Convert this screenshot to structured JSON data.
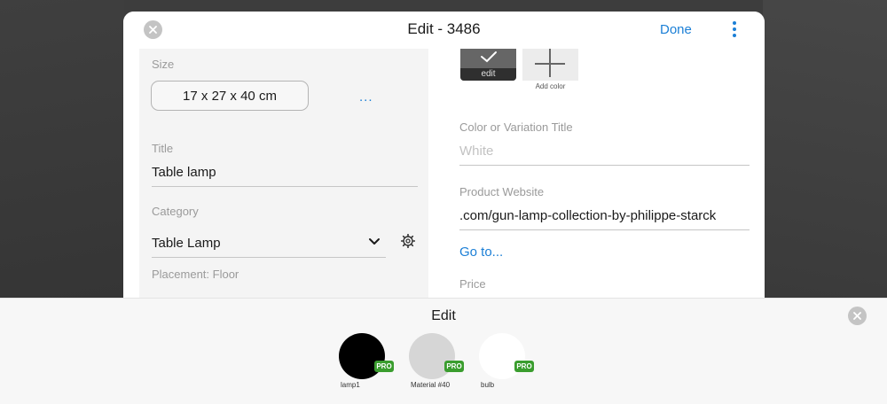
{
  "modal": {
    "title": "Edit - 3486",
    "done_label": "Done"
  },
  "left": {
    "size_label": "Size",
    "size_value": "17 x 27 x 40 cm",
    "size_more": "...",
    "title_label": "Title",
    "title_value": "Table lamp",
    "category_label": "Category",
    "category_value": "Table Lamp",
    "placement": "Placement: Floor"
  },
  "right": {
    "swatch_edit_label": "edit",
    "add_color_label": "Add color",
    "variation_label": "Color or Variation Title",
    "variation_placeholder": "White",
    "website_label": "Product Website",
    "website_value": ".com/gun-lamp-collection-by-philippe-starck",
    "go_to": "Go to...",
    "price_label": "Price"
  },
  "sheet": {
    "title": "Edit",
    "materials": [
      {
        "label": "lamp1",
        "color": "#000000",
        "badge": "PRO"
      },
      {
        "label": "Material #40",
        "color": "#d6d6d6",
        "badge": "PRO"
      },
      {
        "label": "bulb",
        "color": "#ffffff",
        "badge": "PRO"
      }
    ]
  },
  "colors": {
    "accent": "#1b7fd6",
    "pro_badge": "#3a9d2e"
  }
}
